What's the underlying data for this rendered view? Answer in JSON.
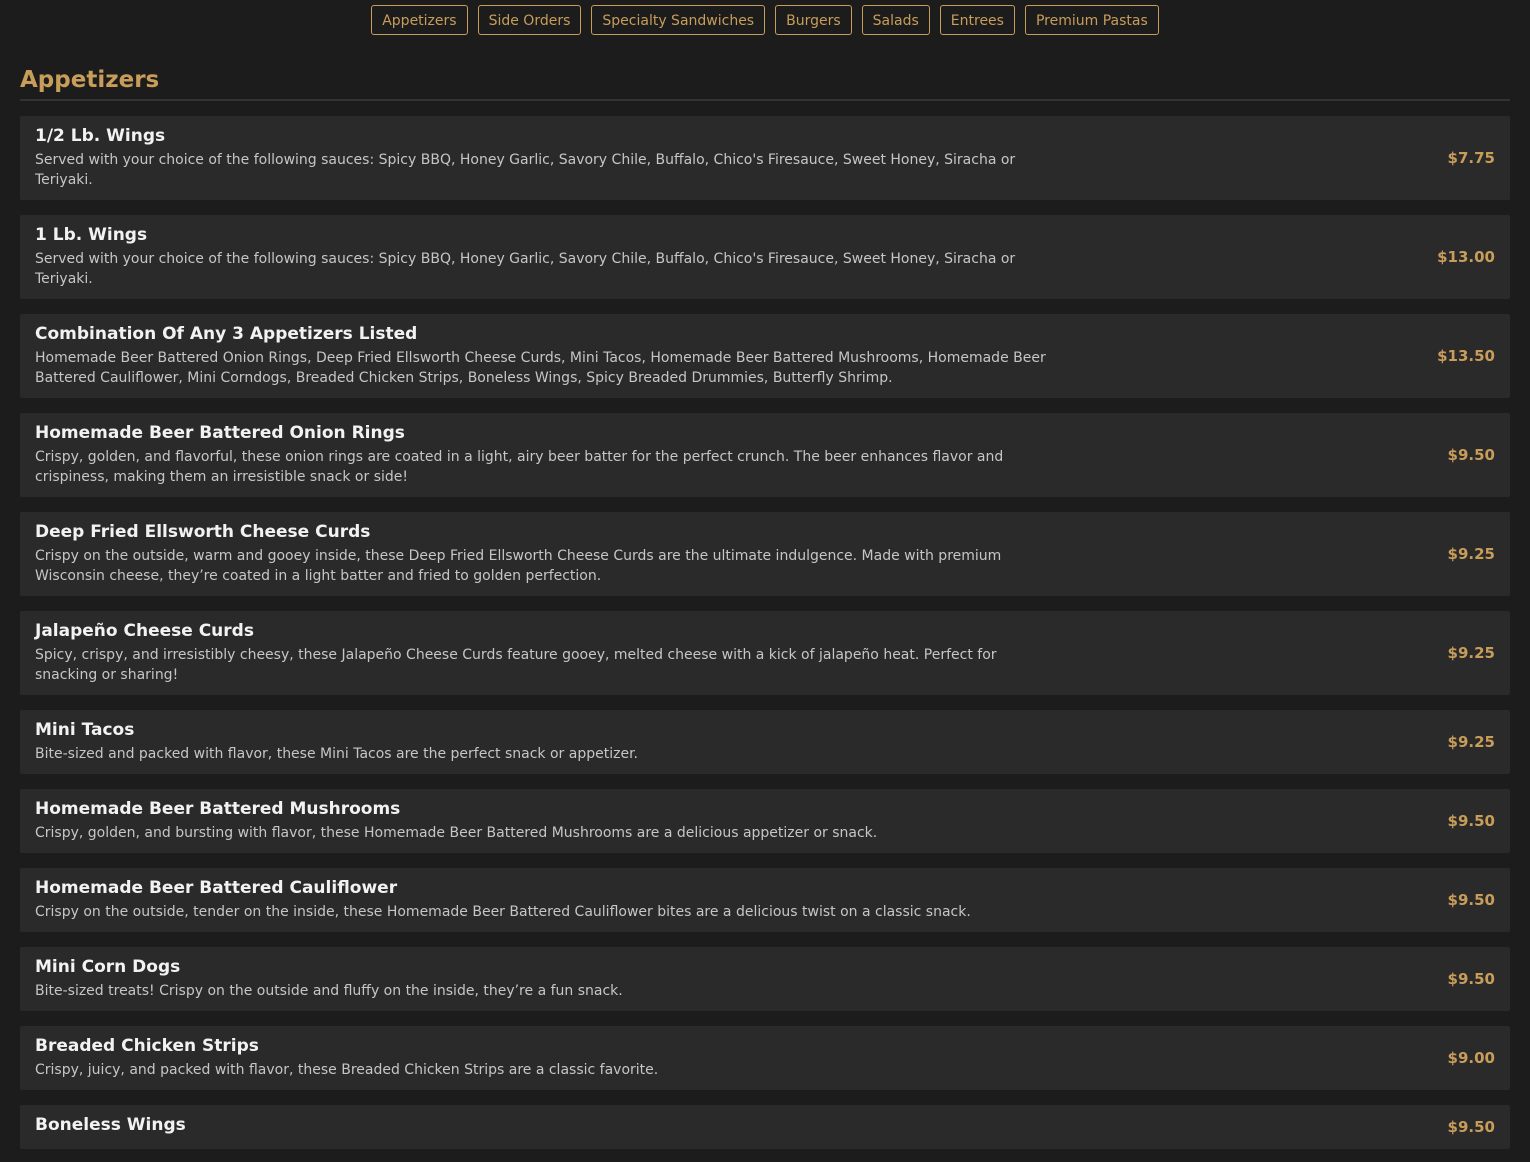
{
  "nav": {
    "tabs": [
      {
        "label": "Appetizers"
      },
      {
        "label": "Side Orders"
      },
      {
        "label": "Specialty Sandwiches"
      },
      {
        "label": "Burgers"
      },
      {
        "label": "Salads"
      },
      {
        "label": "Entrees"
      },
      {
        "label": "Premium Pastas"
      }
    ]
  },
  "section": {
    "title": "Appetizers",
    "items": [
      {
        "name": "1/2 Lb. Wings",
        "description": "Served with your choice of the following sauces: Spicy BBQ, Honey Garlic, Savory Chile, Buffalo, Chico's Firesauce, Sweet Honey, Siracha or Teriyaki.",
        "price": "$7.75"
      },
      {
        "name": "1 Lb. Wings",
        "description": "Served with your choice of the following sauces: Spicy BBQ, Honey Garlic, Savory Chile, Buffalo, Chico's Firesauce, Sweet Honey, Siracha or Teriyaki.",
        "price": "$13.00"
      },
      {
        "name": "Combination Of Any 3 Appetizers Listed",
        "description": "Homemade Beer Battered Onion Rings, Deep Fried Ellsworth Cheese Curds, Mini Tacos, Homemade Beer Battered Mushrooms, Homemade Beer Battered Cauliflower, Mini Corndogs, Breaded Chicken Strips, Boneless Wings, Spicy Breaded Drummies, Butterfly Shrimp.",
        "price": "$13.50"
      },
      {
        "name": "Homemade Beer Battered Onion Rings",
        "description": "Crispy, golden, and flavorful, these onion rings are coated in a light, airy beer batter for the perfect crunch. The beer enhances flavor and crispiness, making them an irresistible snack or side!",
        "price": "$9.50"
      },
      {
        "name": "Deep Fried Ellsworth Cheese Curds",
        "description": "Crispy on the outside, warm and gooey inside, these Deep Fried Ellsworth Cheese Curds are the ultimate indulgence. Made with premium Wisconsin cheese, they’re coated in a light batter and fried to golden perfection.",
        "price": "$9.25"
      },
      {
        "name": "Jalapeño Cheese Curds",
        "description": "Spicy, crispy, and irresistibly cheesy, these Jalapeño Cheese Curds feature gooey, melted cheese with a kick of jalapeño heat. Perfect for snacking or sharing!",
        "price": "$9.25"
      },
      {
        "name": "Mini Tacos",
        "description": "Bite-sized and packed with flavor, these Mini Tacos are the perfect snack or appetizer.",
        "price": "$9.25"
      },
      {
        "name": "Homemade Beer Battered Mushrooms",
        "description": "Crispy, golden, and bursting with flavor, these Homemade Beer Battered Mushrooms are a delicious appetizer or snack.",
        "price": "$9.50"
      },
      {
        "name": "Homemade Beer Battered Cauliflower",
        "description": "Crispy on the outside, tender on the inside, these Homemade Beer Battered Cauliflower bites are a delicious twist on a classic snack.",
        "price": "$9.50"
      },
      {
        "name": "Mini Corn Dogs",
        "description": "Bite-sized treats! Crispy on the outside and fluffy on the inside, they’re a fun snack.",
        "price": "$9.50"
      },
      {
        "name": "Breaded Chicken Strips",
        "description": "Crispy, juicy, and packed with flavor, these Breaded Chicken Strips are a classic favorite.",
        "price": "$9.00"
      },
      {
        "name": "Boneless Wings",
        "description": "",
        "price": "$9.50"
      }
    ]
  }
}
